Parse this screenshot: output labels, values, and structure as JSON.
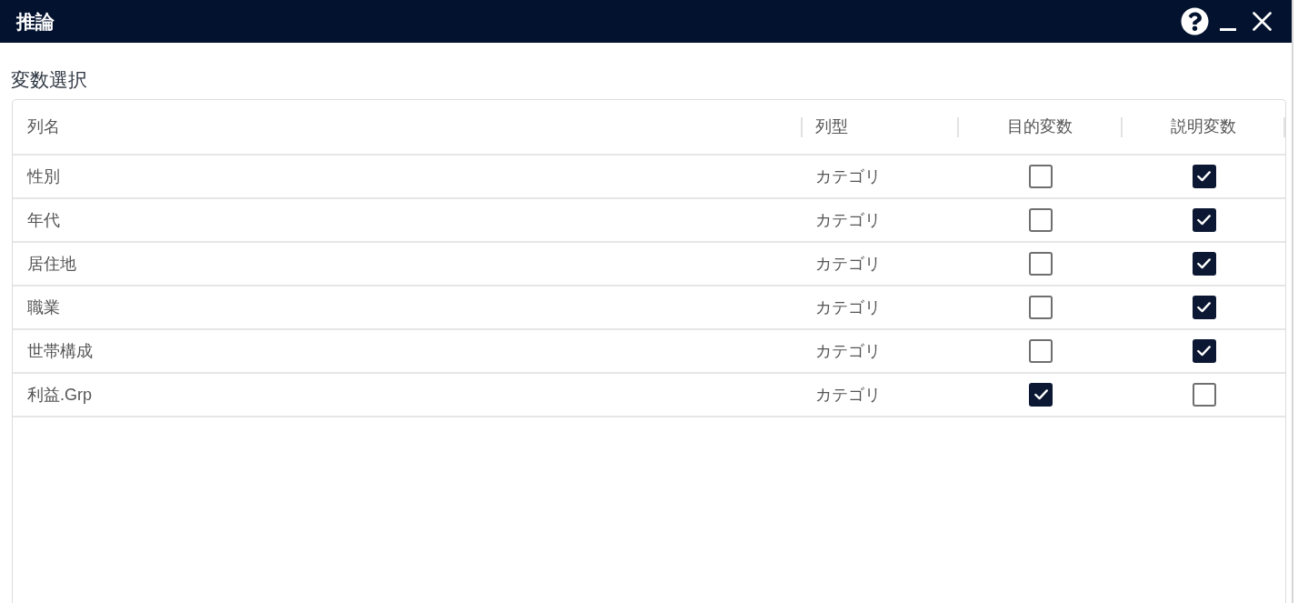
{
  "window": {
    "title": "推論"
  },
  "section": {
    "title": "変数選択"
  },
  "table": {
    "columns": [
      "列名",
      "列型",
      "目的変数",
      "説明変数"
    ],
    "rows": [
      {
        "name": "性別",
        "type": "カテゴリ",
        "target": false,
        "explanatory": true
      },
      {
        "name": "年代",
        "type": "カテゴリ",
        "target": false,
        "explanatory": true
      },
      {
        "name": "居住地",
        "type": "カテゴリ",
        "target": false,
        "explanatory": true
      },
      {
        "name": "職業",
        "type": "カテゴリ",
        "target": false,
        "explanatory": true
      },
      {
        "name": "世帯構成",
        "type": "カテゴリ",
        "target": false,
        "explanatory": true
      },
      {
        "name": "利益.Grp",
        "type": "カテゴリ",
        "target": true,
        "explanatory": false
      }
    ]
  }
}
